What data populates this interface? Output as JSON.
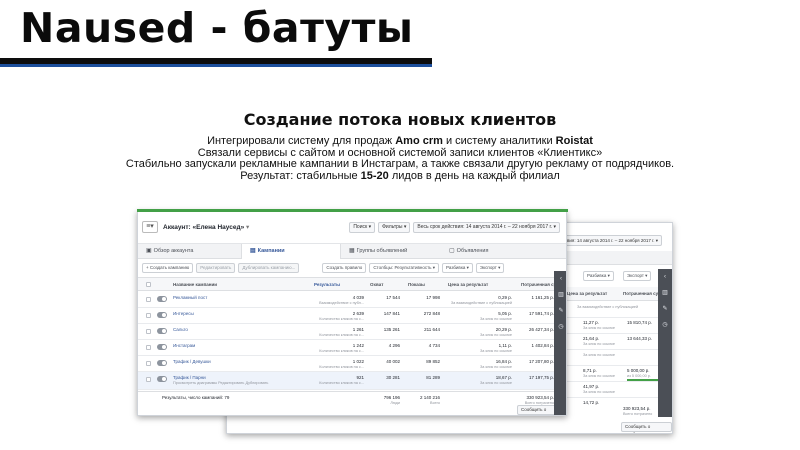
{
  "slide": {
    "title": "Naused - батуты",
    "heading": "Создание потока новых клиентов",
    "line1_pre": "Интегрировали систему для продаж ",
    "line1_bold1": "Amo crm",
    "line1_mid": " и систему аналитики ",
    "line1_bold2": "Roistat",
    "line2": "Связали сервисы с сайтом и основной системой записи клиентов «Клиентикс»",
    "line3": "Стабильно запускали рекламные кампании в Инстаграм, а также связали другую рекламу от подрядчиков.",
    "line4_pre": "Результат: стабильные ",
    "line4_bold": "15-20",
    "line4_post": " лидов в день на каждый филиал"
  },
  "front": {
    "account": "Аккаунт: «Елена Наусед»",
    "search": "Поиск ▾",
    "filters": "Фильтры ▾",
    "date_range": "Весь срок действия: 14 августа 2014 г. – 22 ноября 2017 г. ▾",
    "tabs": [
      "Обзор аккаунта",
      "Кампании",
      "Группы объявлений",
      "Объявления"
    ],
    "toolbar": {
      "create": "+ Создать кампанию",
      "edit": "Редактировать",
      "duplicate": "Дублировать кампанию...",
      "create_rule": "Создать правило",
      "columns": "Столбцы: Результативность ▾",
      "breakdown": "Разбивка ▾",
      "export": "Экспорт ▾"
    },
    "headers": [
      "Название кампании",
      "Результаты",
      "Охват",
      "Показы",
      "Цена за результат",
      "Потраченная сумма"
    ],
    "rows": [
      {
        "name": "Рекламный пост",
        "results": "4 039",
        "results_sub": "Взаимодействие с публ...",
        "reach": "17 544",
        "impressions": "17 998",
        "cost": "0,29 р.",
        "cost_sub": "За взаимодействие с публикацией",
        "spent": "1 161,25 р."
      },
      {
        "name": "Интересы",
        "results": "2 639",
        "results_sub": "Количество кликов на с...",
        "reach": "147 841",
        "impressions": "272 848",
        "cost": "5,05 р.",
        "cost_sub": "За клик по ссылке",
        "spent": "17 591,74 р."
      },
      {
        "name": "Сальто",
        "results": "1 261",
        "results_sub": "Количество кликов на с...",
        "reach": "135 261",
        "impressions": "211 644",
        "cost": "20,29 р.",
        "cost_sub": "За клик по ссылке",
        "spent": "26 427,34 р."
      },
      {
        "name": "Инстаграм",
        "results": "1 242",
        "results_sub": "Количество кликов на с...",
        "reach": "4 296",
        "impressions": "4 734",
        "cost": "1,11 р.",
        "cost_sub": "За клик по ссылке",
        "spent": "1 402,84 р."
      },
      {
        "name": "Трафик / Девушки",
        "results": "1 022",
        "results_sub": "Количество кликов на с...",
        "reach": "40 002",
        "impressions": "89 852",
        "cost": "16,84 р.",
        "cost_sub": "За клик по ссылке",
        "spent": "17 207,80 р."
      },
      {
        "name": "Трафик / Парни",
        "results": "921",
        "results_sub": "Количество кликов на с...",
        "reach": "30 281",
        "impressions": "81 289",
        "cost": "18,67 р.",
        "cost_sub": "За клик по ссылке",
        "spent": "17 197,75 р."
      }
    ],
    "row6_links": "Просмотреть диаграммы  Редактировать  Дублировать",
    "total_label": "Результаты, число кампаний: 79",
    "total_reach": "796 196",
    "total_reach_sub": "Люди",
    "total_impressions": "2 140 216",
    "total_impressions_sub": "Всего",
    "total_spent": "330 923,54 р.",
    "total_spent_sub": "Всего потрачено",
    "report": "Сообщить о проблеме"
  },
  "back": {
    "date_range": "Весь срок действия: 14 августа 2014 г. – 22 ноября 2017 г. ▾",
    "breakdown": "Разбивка ▾",
    "export": "Экспорт ▾",
    "col_cost": "Цена за результат",
    "col_spent": "Потраченная сумма",
    "rows": [
      {
        "cost": "",
        "cost_sub": "За взаимодействие с публикацией",
        "spent": "",
        "spent_sub": ""
      },
      {
        "cost": "11,27 р.",
        "cost_sub": "За клик по ссылке",
        "spent": "15 810,74 р.",
        "spent_sub": ""
      },
      {
        "cost": "21,64 р.",
        "cost_sub": "За клик по ссылке",
        "spent": "13 644,33 р.",
        "spent_sub": ""
      },
      {
        "cost": "",
        "cost_sub": "За клик по ссылке",
        "spent": "",
        "spent_sub": ""
      },
      {
        "cost": "8,71 р.",
        "cost_sub": "За клик по ссылке",
        "spent": "5 000,00 р.",
        "spent_sub": "из 5 000,00 р."
      },
      {
        "cost": "41,97 р.",
        "cost_sub": "За клик по ссылке",
        "spent": "",
        "spent_sub": ""
      },
      {
        "cost": "14,72 р.",
        "cost_sub": "",
        "spent": "",
        "spent_sub": ""
      }
    ],
    "total_spent": "330 923,54 р.",
    "total_spent_sub": "Всего потрачено",
    "report": "Сообщить о проблеме"
  },
  "icons": {
    "rail": [
      "chevron-icon",
      "bar-chart-icon",
      "pencil-icon",
      "clock-icon"
    ]
  },
  "colors": {
    "accent_blue": "#1d4f9c",
    "link_blue": "#365899",
    "green": "#43a047"
  }
}
